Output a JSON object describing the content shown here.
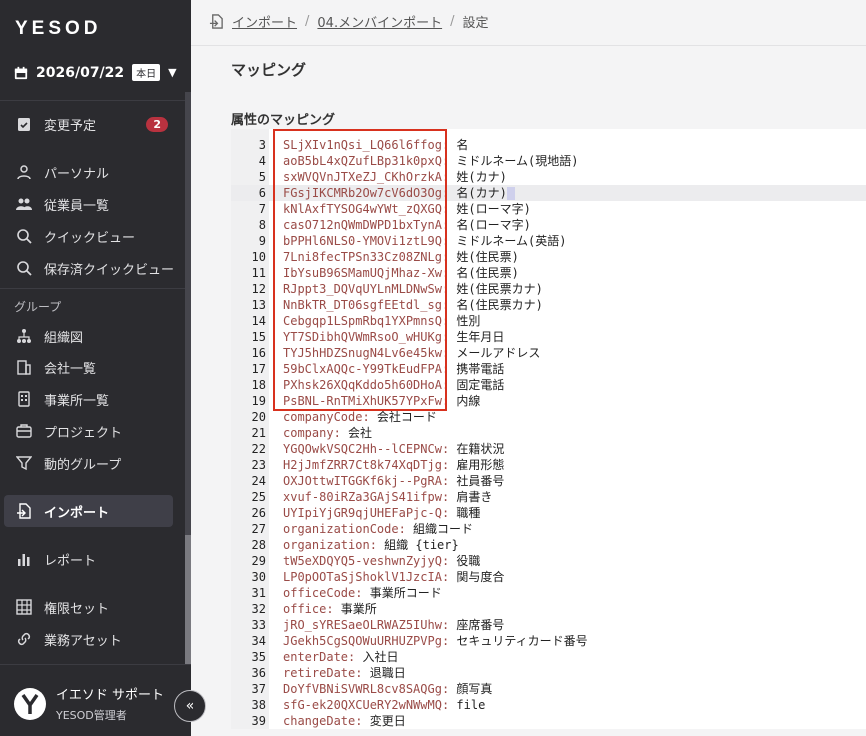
{
  "app": {
    "logo": "YESOD"
  },
  "sidebar": {
    "date": "2026/07/22",
    "today_badge": "本日",
    "items": [
      {
        "label": "変更予定",
        "icon": "clipboard-check-icon",
        "badge": "2"
      },
      {
        "label": "パーソナル",
        "icon": "person-icon"
      },
      {
        "label": "従業員一覧",
        "icon": "people-icon"
      },
      {
        "label": "クイックビュー",
        "icon": "search-icon"
      },
      {
        "label": "保存済クイックビュー",
        "icon": "search-icon"
      },
      {
        "label": "組織図",
        "icon": "org-chart-icon"
      },
      {
        "label": "会社一覧",
        "icon": "building-icon"
      },
      {
        "label": "事業所一覧",
        "icon": "office-icon"
      },
      {
        "label": "プロジェクト",
        "icon": "briefcase-icon"
      },
      {
        "label": "動的グループ",
        "icon": "filter-icon"
      },
      {
        "label": "インポート",
        "icon": "import-icon"
      },
      {
        "label": "レポート",
        "icon": "bar-chart-icon"
      },
      {
        "label": "権限セット",
        "icon": "grid-icon"
      },
      {
        "label": "業務アセット",
        "icon": "link-icon"
      }
    ],
    "group_label": "グループ",
    "user": {
      "name": "イエソド サポート",
      "role": "YESOD管理者"
    }
  },
  "breadcrumb": {
    "items": [
      "インポート",
      "04.メンバインポート",
      "設定"
    ]
  },
  "main": {
    "section_title": "マッピング",
    "sub_title": "属性のマッピング"
  },
  "editor": {
    "lines": [
      {
        "n": "3",
        "key": "SLjXIv1nQsi_LQ66l6ffog:",
        "val": " 名"
      },
      {
        "n": "4",
        "key": "aoB5bL4xQZufLBp31k0pxQ:",
        "val": " ミドルネーム(現地語)"
      },
      {
        "n": "5",
        "key": "sxWVQVnJTXeZJ_CKhOrzkA:",
        "val": " 姓(カナ)"
      },
      {
        "n": "6",
        "key": "FGsjIKCMRb2Ow7cV6dO3Og:",
        "val": " 名(カナ)"
      },
      {
        "n": "7",
        "key": "kNlAxfTYSOG4wYWt_zQXGQ:",
        "val": " 姓(ローマ字)"
      },
      {
        "n": "8",
        "key": "casO712nQWmDWPD1bxTynA:",
        "val": " 名(ローマ字)"
      },
      {
        "n": "9",
        "key": "bPPHl6NLS0-YMOVi1ztL9Q:",
        "val": " ミドルネーム(英語)"
      },
      {
        "n": "10",
        "key": "7Lni8fecTPSn33Cz08ZNLg:",
        "val": " 姓(住民票)"
      },
      {
        "n": "11",
        "key": "IbYsuB96SMamUQjMhaz-Xw:",
        "val": " 名(住民票)"
      },
      {
        "n": "12",
        "key": "RJppt3_DQVqUYLnMLDNwSw:",
        "val": " 姓(住民票カナ)"
      },
      {
        "n": "13",
        "key": "NnBkTR_DT06sgfEEtdl_sg:",
        "val": " 名(住民票カナ)"
      },
      {
        "n": "14",
        "key": "Cebgqp1LSpmRbq1YXPmnsQ:",
        "val": " 性別"
      },
      {
        "n": "15",
        "key": "YT7SDibhQVWmRsoO_wHUKg:",
        "val": " 生年月日"
      },
      {
        "n": "16",
        "key": "TYJ5hHDZSnugN4Lv6e45kw:",
        "val": " メールアドレス"
      },
      {
        "n": "17",
        "key": "59bClxAQQc-Y99TkEudFPA:",
        "val": " 携帯電話"
      },
      {
        "n": "18",
        "key": "PXhsk26XQqKddo5h60DHoA:",
        "val": " 固定電話"
      },
      {
        "n": "19",
        "key": "PsBNL-RnTMiXhUK57YPxFw:",
        "val": " 内線"
      },
      {
        "n": "20",
        "key": "companyCode:",
        "val": " 会社コード"
      },
      {
        "n": "21",
        "key": "company:",
        "val": " 会社"
      },
      {
        "n": "22",
        "key": "YGQOwkVSQC2Hh--lCEPNCw:",
        "val": " 在籍状況"
      },
      {
        "n": "23",
        "key": "H2jJmfZRR7Ct8k74XqDTjg:",
        "val": " 雇用形態"
      },
      {
        "n": "24",
        "key": "OXJOttwITGGKf6kj--PgRA:",
        "val": " 社員番号"
      },
      {
        "n": "25",
        "key": "xvuf-80iRZa3GAjS41ifpw:",
        "val": " 肩書き"
      },
      {
        "n": "26",
        "key": "UYIpiYjGR9qjUHEFaPjc-Q:",
        "val": " 職種"
      },
      {
        "n": "27",
        "key": "organizationCode:",
        "val": " 組織コード"
      },
      {
        "n": "28",
        "key": "organization:",
        "val": " 組織 {tier}"
      },
      {
        "n": "29",
        "key": "tW5eXDQYQ5-veshwnZyjyQ:",
        "val": " 役職"
      },
      {
        "n": "30",
        "key": "LP0pOOTaSjShoklV1JzcIA:",
        "val": " 関与度合"
      },
      {
        "n": "31",
        "key": "officeCode:",
        "val": " 事業所コード"
      },
      {
        "n": "32",
        "key": "office:",
        "val": " 事業所"
      },
      {
        "n": "33",
        "key": "jRO_sYRESaeOLRWAZ5IUhw:",
        "val": " 座席番号"
      },
      {
        "n": "34",
        "key": "JGekh5CgSQOWuURHUZPVPg:",
        "val": " セキュリティカード番号"
      },
      {
        "n": "35",
        "key": "enterDate:",
        "val": " 入社日"
      },
      {
        "n": "36",
        "key": "retireDate:",
        "val": " 退職日"
      },
      {
        "n": "37",
        "key": "DoYfVBNiSVWRL8cv8SAQGg:",
        "val": " 顔写真"
      },
      {
        "n": "38",
        "key": "sfG-ek20QXCUeRY2wNWwMQ:",
        "val": " file"
      },
      {
        "n": "39",
        "key": "changeDate:",
        "val": " 変更日"
      }
    ]
  }
}
